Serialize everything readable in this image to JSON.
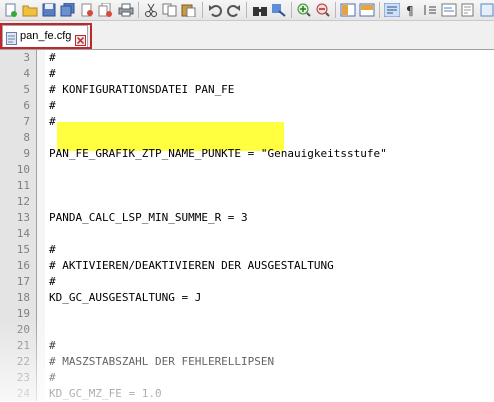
{
  "tab": {
    "filename": "pan_fe.cfg"
  },
  "editor": {
    "lines": [
      {
        "num": "3",
        "text": "#"
      },
      {
        "num": "4",
        "text": "#"
      },
      {
        "num": "5",
        "text": "# KONFIGURATIONSDATEI PAN_FE"
      },
      {
        "num": "6",
        "text": "#"
      },
      {
        "num": "7",
        "text": "#"
      },
      {
        "num": "8",
        "text": ""
      },
      {
        "num": "9",
        "text": "PAN_FE_GRAFIK_ZTP_NAME_PUNKTE = \"Genauigkeitsstufe\""
      },
      {
        "num": "10",
        "text": ""
      },
      {
        "num": "11",
        "text": ""
      },
      {
        "num": "12",
        "text": ""
      },
      {
        "num": "13",
        "text": "PANDA_CALC_LSP_MIN_SUMME_R = 3"
      },
      {
        "num": "14",
        "text": ""
      },
      {
        "num": "15",
        "text": "#"
      },
      {
        "num": "16",
        "text": "# AKTIVIEREN/DEAKTIVIEREN DER AUSGESTALTUNG"
      },
      {
        "num": "17",
        "text": "#"
      },
      {
        "num": "18",
        "text": "KD_GC_AUSGESTALTUNG = J"
      },
      {
        "num": "19",
        "text": ""
      },
      {
        "num": "20",
        "text": ""
      },
      {
        "num": "21",
        "text": "#"
      },
      {
        "num": "22",
        "text": "# MASZSTABSZAHL DER FEHLERELLIPSEN"
      },
      {
        "num": "23",
        "text": "#"
      },
      {
        "num": "24",
        "text": "KD_GC_MZ_FE = 1.0"
      }
    ]
  },
  "colors": {
    "highlight": "#ffff40",
    "tab_outline": "#c0272d"
  }
}
